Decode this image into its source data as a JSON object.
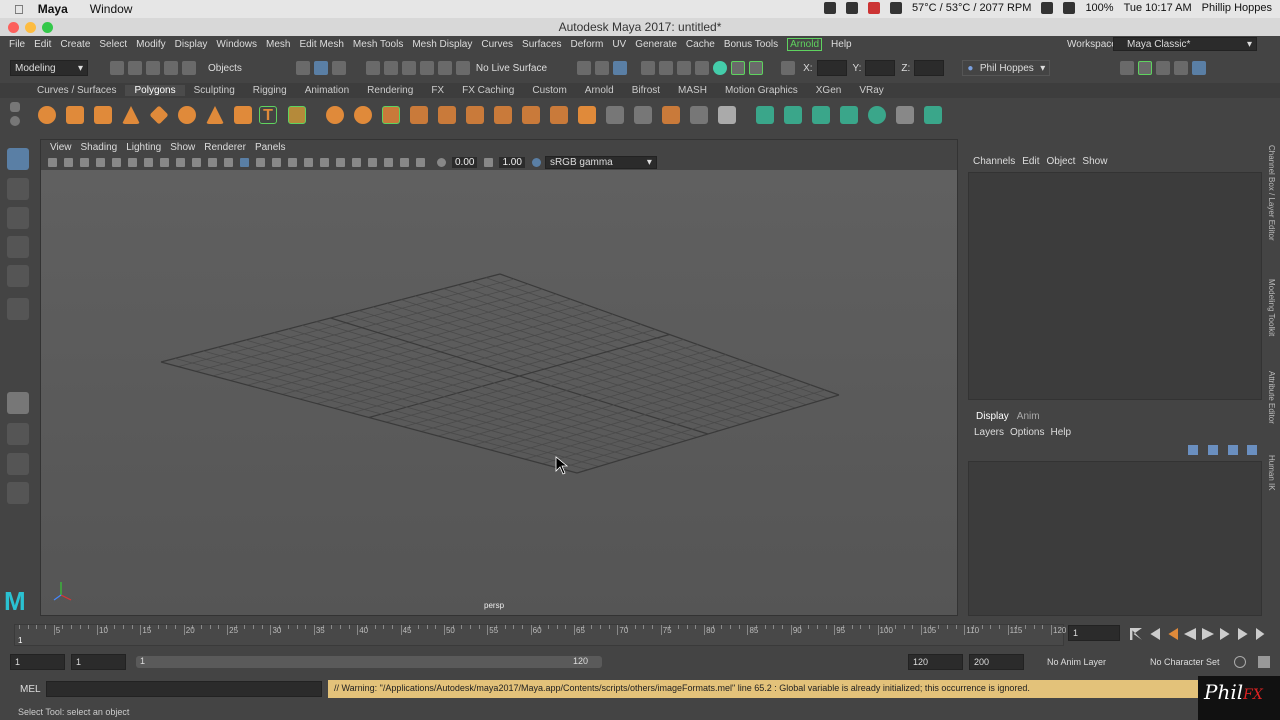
{
  "mac_menubar": {
    "app": "Maya",
    "items": [
      "Window"
    ],
    "status_temp": "57°C / 53°C / 2077 RPM",
    "battery": "100%",
    "clock": "Tue 10:17 AM",
    "user": "Phillip Hoppes"
  },
  "window_title": "Autodesk Maya 2017: untitled*",
  "main_menu": [
    "File",
    "Edit",
    "Create",
    "Select",
    "Modify",
    "Display",
    "Windows",
    "Mesh",
    "Edit Mesh",
    "Mesh Tools",
    "Mesh Display",
    "Curves",
    "Surfaces",
    "Deform",
    "UV",
    "Generate",
    "Cache",
    "Bonus Tools",
    "Arnold",
    "Help"
  ],
  "workspace": {
    "label": "Workspace :",
    "value": "Maya Classic*"
  },
  "status_line": {
    "menuset": "Modeling",
    "selection_mode": "Objects",
    "live_surface": "No Live Surface",
    "x_label": "X:",
    "y_label": "Y:",
    "z_label": "Z:",
    "account": "Phil Hoppes"
  },
  "shelf_tabs": [
    "Curves / Surfaces",
    "Polygons",
    "Sculpting",
    "Rigging",
    "Animation",
    "Rendering",
    "FX",
    "FX Caching",
    "Custom",
    "Arnold",
    "Bifrost",
    "MASH",
    "Motion Graphics",
    "XGen",
    "VRay"
  ],
  "active_shelf": "Polygons",
  "viewport": {
    "menu": [
      "View",
      "Shading",
      "Lighting",
      "Show",
      "Renderer",
      "Panels"
    ],
    "exposure": "0.00",
    "gamma": "1.00",
    "color_space": "sRGB gamma",
    "camera": "persp"
  },
  "channel_box": {
    "menu": [
      "Channels",
      "Edit",
      "Object",
      "Show"
    ],
    "layer_tabs": [
      "Display",
      "Anim"
    ],
    "layer_menu": [
      "Layers",
      "Options",
      "Help"
    ]
  },
  "side_tabs": [
    "Channel Box / Layer Editor",
    "Modeling Toolkit",
    "Attribute Editor",
    "Human IK"
  ],
  "timeline": {
    "ticks": [
      5,
      10,
      15,
      20,
      25,
      30,
      35,
      40,
      45,
      50,
      55,
      60,
      65,
      70,
      75,
      80,
      85,
      90,
      95,
      100,
      105,
      110,
      115,
      120
    ],
    "start_label": "1",
    "current_frame": "1"
  },
  "range_slider": {
    "start": "1",
    "playback_start": "1",
    "handle_start": "1",
    "handle_end": "120",
    "playback_end": "120",
    "end": "200",
    "anim_layer": "No Anim Layer",
    "character_set": "No Character Set"
  },
  "command_line": {
    "label": "MEL",
    "warning": "// Warning: \"/Applications/Autodesk/maya2017/Maya.app/Contents/scripts/others/imageFormats.mel\" line 65.2 : Global variable is already initialized; this occurrence is ignored."
  },
  "help_line": "Select Tool: select an object",
  "watermark": {
    "part1": "Phil",
    "part2": "FX"
  }
}
